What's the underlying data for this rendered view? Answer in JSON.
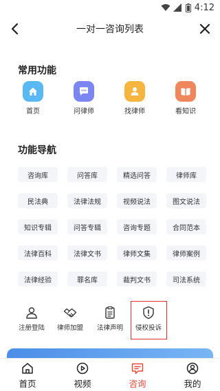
{
  "status_bar": {
    "time": "4:12"
  },
  "header": {
    "title": "一对一咨询列表"
  },
  "common_functions": {
    "title": "常用功能",
    "items": [
      {
        "label": "首页",
        "icon": "home-icon",
        "color": "#5ab8f5"
      },
      {
        "label": "问律师",
        "icon": "chat-icon",
        "color": "#7b86f2"
      },
      {
        "label": "找律师",
        "icon": "lawyer-icon",
        "color": "#f5b53f"
      },
      {
        "label": "看知识",
        "icon": "book-icon",
        "color": "#f0875c"
      }
    ]
  },
  "nav": {
    "title": "功能导航",
    "items": [
      "咨询库",
      "问答库",
      "精选问答",
      "律师库",
      "民法典",
      "法律法规",
      "视频说法",
      "图文说法",
      "知识专辑",
      "问答专辑",
      "咨询专题",
      "合同范本",
      "法律百科",
      "法律文书",
      "律师文集",
      "律师案例",
      "法律经验",
      "罪名库",
      "裁判文书",
      "司法系统"
    ]
  },
  "bottom_links": [
    {
      "label": "注册登陆",
      "icon": "user-icon"
    },
    {
      "label": "律师加盟",
      "icon": "handshake-icon"
    },
    {
      "label": "法律声明",
      "icon": "clipboard-icon"
    },
    {
      "label": "侵权投诉",
      "icon": "shield-alert-icon"
    }
  ],
  "tabbar": {
    "items": [
      {
        "label": "首页",
        "icon": "home-outline-icon",
        "active": false
      },
      {
        "label": "视频",
        "icon": "video-icon",
        "active": false
      },
      {
        "label": "咨询",
        "icon": "consult-icon",
        "active": true
      },
      {
        "label": "我的",
        "icon": "profile-icon",
        "active": false
      }
    ]
  },
  "colors": {
    "accent": "#e84a3a",
    "highlight": "#e03131",
    "banner": "#4c8ee8",
    "chip_bg": "#f3f5f9"
  }
}
